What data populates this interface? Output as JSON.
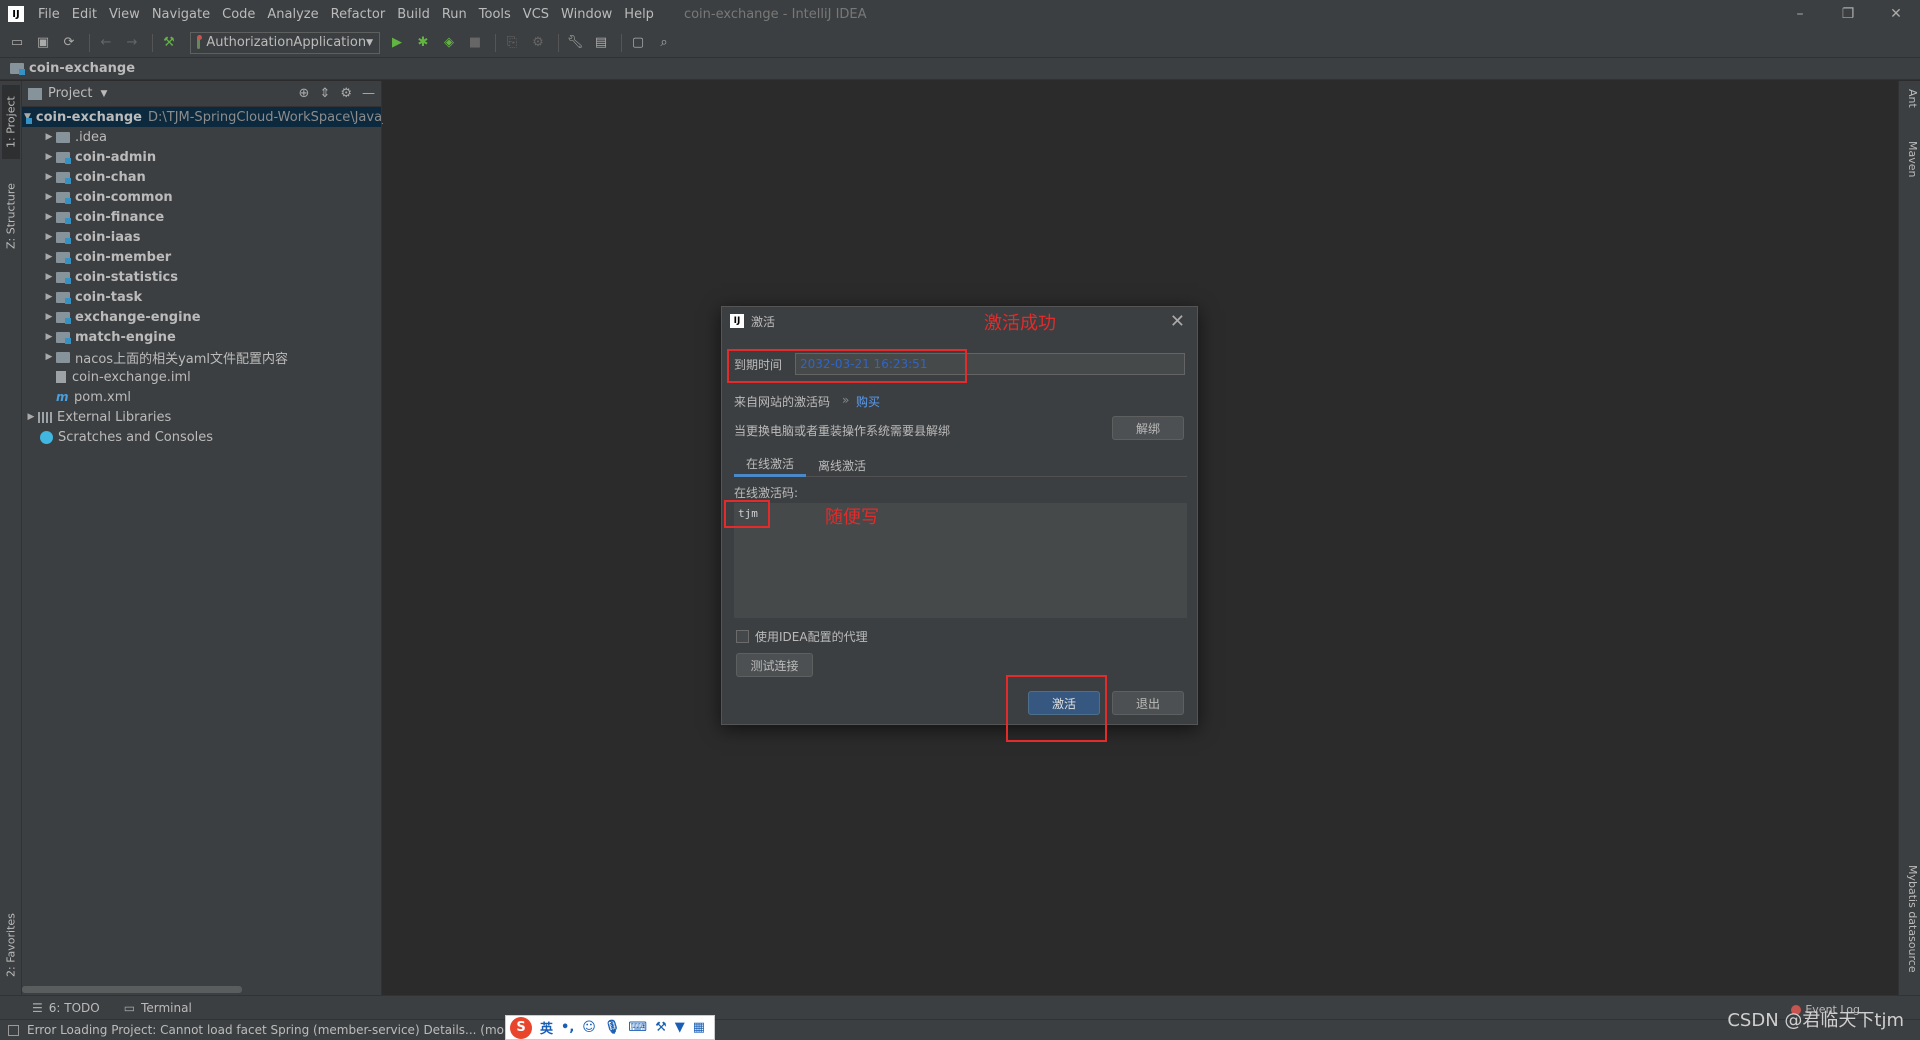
{
  "window": {
    "title": "coin-exchange - IntelliJ IDEA",
    "logo": "IJ",
    "controls": [
      "–",
      "❐",
      "✕"
    ]
  },
  "menu": [
    "File",
    "Edit",
    "View",
    "Navigate",
    "Code",
    "Analyze",
    "Refactor",
    "Build",
    "Run",
    "Tools",
    "VCS",
    "Window",
    "Help"
  ],
  "toolbar": {
    "run_config": "AuthorizationApplication",
    "icons": [
      "open-folder-icon",
      "save-icon",
      "sync-icon",
      "back-icon",
      "forward-icon",
      "build-hammer-icon",
      "run-icon",
      "debug-icon",
      "coverage-icon",
      "stop-icon",
      "attach-icon",
      "profiler-icon",
      "wrench-icon",
      "project-structure-icon",
      "layout-icon",
      "search-icon"
    ]
  },
  "navbar": {
    "project": "coin-exchange"
  },
  "left_strip": {
    "project_tab": "1: Project",
    "structure_tab": "Z: Structure",
    "favorites_tab": "2: Favorites"
  },
  "right_strip": {
    "ant_tab": "Ant",
    "maven_tab": "Maven",
    "mybatis_tab": "Mybatis datasource"
  },
  "project_panel": {
    "header": "Project",
    "root": {
      "name": "coin-exchange",
      "path": "D:\\TJM-SpringCloud-WorkSpace\\Java_"
    },
    "children": [
      {
        "name": ".idea",
        "bold": false
      },
      {
        "name": "coin-admin",
        "bold": true
      },
      {
        "name": "coin-chan",
        "bold": true
      },
      {
        "name": "coin-common",
        "bold": true
      },
      {
        "name": "coin-finance",
        "bold": true
      },
      {
        "name": "coin-iaas",
        "bold": true
      },
      {
        "name": "coin-member",
        "bold": true
      },
      {
        "name": "coin-statistics",
        "bold": true
      },
      {
        "name": "coin-task",
        "bold": true
      },
      {
        "name": "exchange-engine",
        "bold": true
      },
      {
        "name": "match-engine",
        "bold": true
      },
      {
        "name": "nacos上面的相关yaml文件配置内容",
        "bold": false
      }
    ],
    "files": [
      "coin-exchange.iml",
      "pom.xml"
    ],
    "external_libraries": "External Libraries",
    "scratches": "Scratches and Consoles"
  },
  "dialog": {
    "title": "激活",
    "expiry_label": "到期时间",
    "expiry_value": "2032-03-21 16:23:51",
    "source_label": "来自网站的激活码",
    "buy_link": "购买",
    "unbind_hint": "当更换电脑或者重装操作系统需要县解绑",
    "unbind_button": "解绑",
    "tabs": [
      "在线激活",
      "离线激活"
    ],
    "code_label": "在线激活码:",
    "code_value": "tjm",
    "proxy_label": "使用IDEA配置的代理",
    "test_button": "测试连接",
    "activate_button": "激活",
    "exit_button": "退出"
  },
  "annotations": {
    "success": "激活成功",
    "write_anything": "随便写"
  },
  "bottom_bar": {
    "todo": "6: TODO",
    "terminal": "Terminal"
  },
  "status_bar": {
    "message": "Error Loading Project: Cannot load facet Spring (member-service) Details... (momer"
  },
  "ime": {
    "lang": "英"
  },
  "event_log": "Event Log",
  "watermark": "CSDN @君临天下tjm",
  "colors": {
    "annotation_red": "#e32b2b",
    "accent_blue": "#365880",
    "link_blue": "#589df6"
  }
}
